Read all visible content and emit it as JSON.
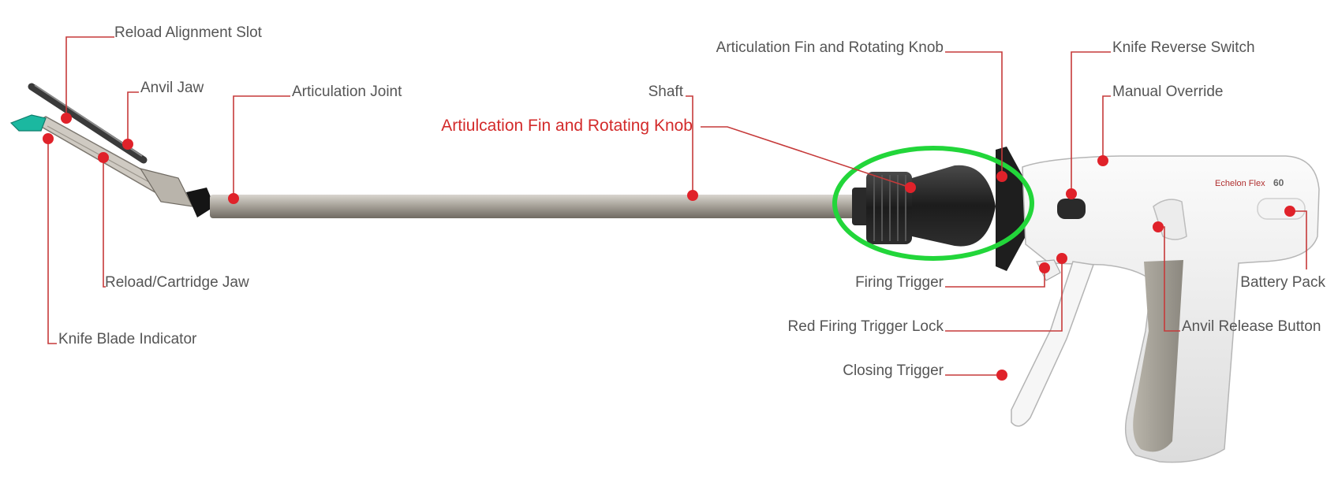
{
  "labels": {
    "reload_alignment_slot": "Reload Alignment Slot",
    "anvil_jaw": "Anvil Jaw",
    "articulation_joint": "Articulation Joint",
    "reload_cartridge_jaw": "Reload/Cartridge Jaw",
    "knife_blade_indicator": "Knife Blade Indicator",
    "shaft": "Shaft",
    "articulation_fin_top": "Articulation Fin and Rotating Knob",
    "articulation_fin_highlight": "Artiulcation Fin and Rotating Knob",
    "knife_reverse_switch": "Knife Reverse Switch",
    "manual_override": "Manual Override",
    "battery_pack": "Battery Pack",
    "anvil_release_button": "Anvil Release Button",
    "firing_trigger": "Firing Trigger",
    "red_firing_trigger_lock": "Red Firing Trigger Lock",
    "closing_trigger": "Closing Trigger"
  },
  "device_marking": {
    "brand": "Echelon Flex",
    "model": "60"
  },
  "colors": {
    "label_text": "#555555",
    "leader_line": "#c63a3a",
    "marker_dot": "#e0222a",
    "highlight_text": "#d32a2a",
    "highlight_ring": "#22d63a",
    "cartridge_tip": "#1bb8a0"
  }
}
